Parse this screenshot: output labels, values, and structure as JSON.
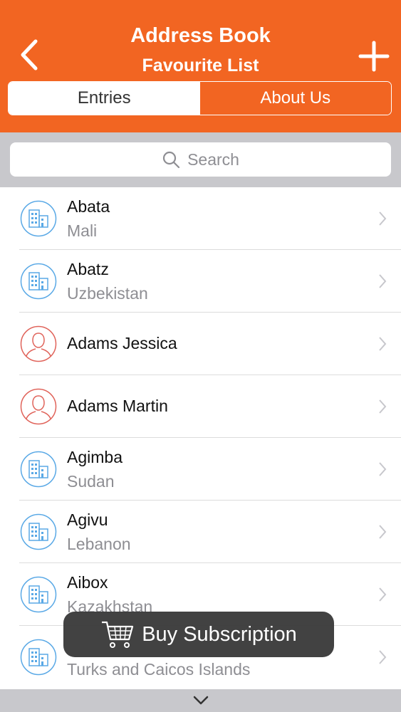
{
  "header": {
    "title": "Address Book",
    "subtitle": "Favourite List",
    "back_icon": "chevron-left-icon",
    "add_icon": "plus-icon"
  },
  "tabs": [
    {
      "label": "Entries",
      "selected": true
    },
    {
      "label": "About Us",
      "selected": false
    }
  ],
  "search": {
    "placeholder": "Search",
    "icon": "search-icon"
  },
  "entries": [
    {
      "name": "Abata",
      "sub": "Mali",
      "type": "building"
    },
    {
      "name": "Abatz",
      "sub": "Uzbekistan",
      "type": "building"
    },
    {
      "name": "Adams Jessica",
      "sub": "",
      "type": "person"
    },
    {
      "name": "Adams Martin",
      "sub": "",
      "type": "person"
    },
    {
      "name": "Agimba",
      "sub": "Sudan",
      "type": "building"
    },
    {
      "name": "Agivu",
      "sub": "Lebanon",
      "type": "building"
    },
    {
      "name": "Aibox",
      "sub": "Kazakhstan",
      "type": "building"
    },
    {
      "name": "",
      "sub": "Turks and Caicos Islands",
      "type": "building"
    }
  ],
  "buy_button": {
    "label": "Buy Subscription",
    "icon": "cart-icon"
  },
  "colors": {
    "accent": "#f26522",
    "building_icon": "#5aa9e6",
    "person_icon": "#e0635a"
  }
}
